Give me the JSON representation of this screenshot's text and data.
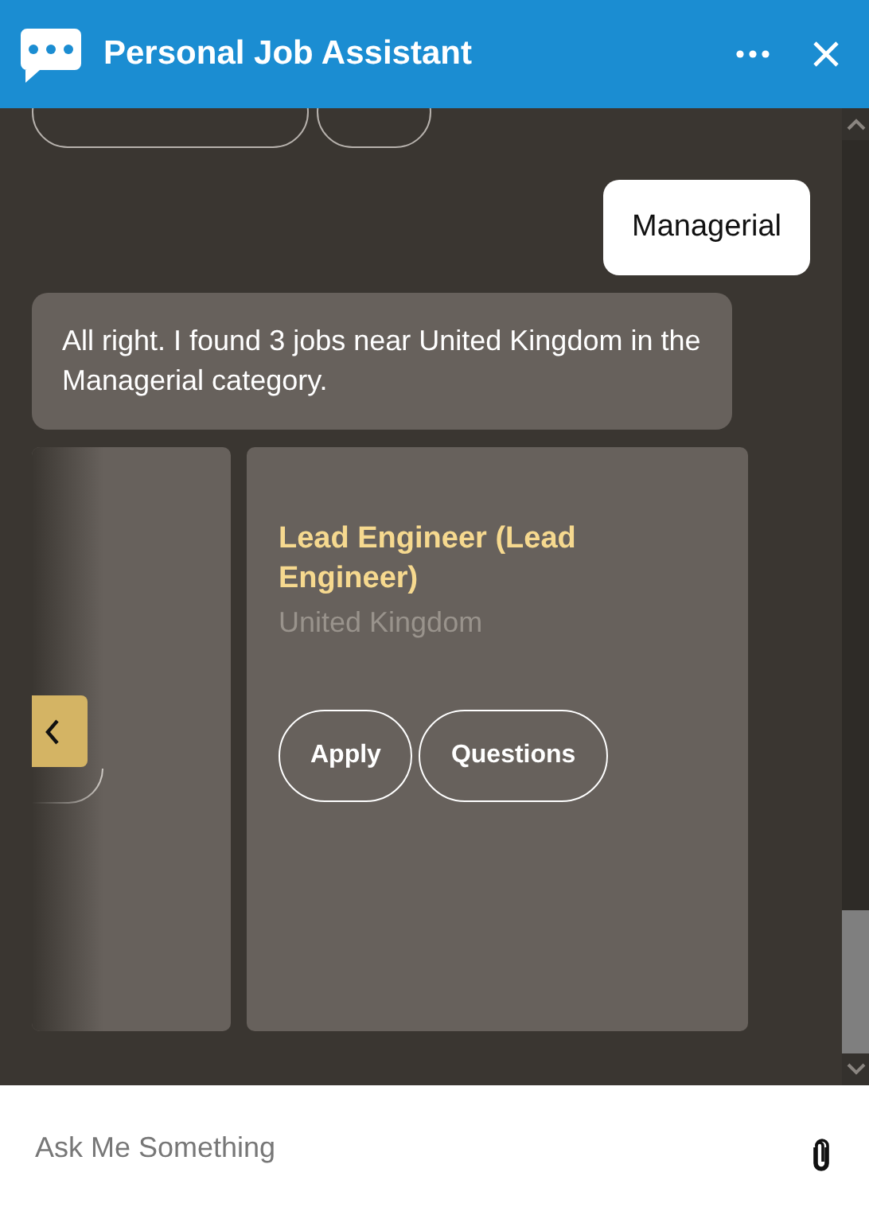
{
  "header": {
    "title": "Personal Job Assistant"
  },
  "messages": [
    {
      "kind": "chips"
    },
    {
      "kind": "user",
      "text": "Managerial"
    },
    {
      "kind": "bot",
      "text": "All right. I found 3 jobs near United Kingdom in the Managerial category."
    },
    {
      "kind": "carousel",
      "cards": [
        {
          "kind": "partial"
        },
        {
          "kind": "job",
          "title": "Lead Engineer (Lead Engineer)",
          "location": "United Kingdom",
          "actions": [
            "Apply",
            "Questions"
          ]
        }
      ]
    }
  ],
  "composer": {
    "placeholder": "Ask Me Something"
  }
}
